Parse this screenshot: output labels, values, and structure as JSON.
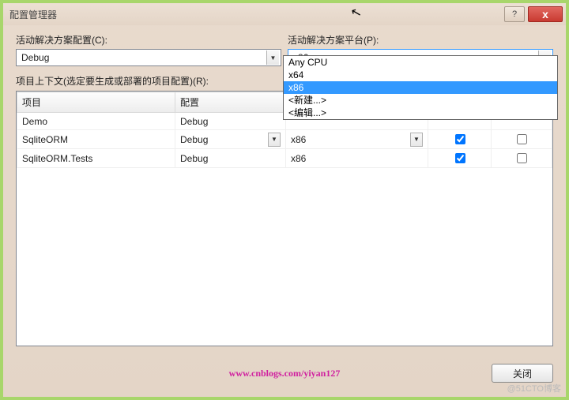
{
  "title": "配置管理器",
  "help_glyph": "?",
  "close_glyph": "x",
  "labels": {
    "solution_config": "活动解决方案配置(C):",
    "solution_platform": "活动解决方案平台(P):",
    "context": "项目上下文(选定要生成或部署的项目配置)(R):"
  },
  "solution_config_value": "Debug",
  "solution_platform_value": "x86",
  "platform_options": [
    {
      "label": "Any CPU",
      "selected": false
    },
    {
      "label": "x64",
      "selected": false
    },
    {
      "label": "x86",
      "selected": true
    },
    {
      "label": "<新建...>",
      "selected": false
    },
    {
      "label": "<编辑...>",
      "selected": false
    }
  ],
  "columns": {
    "project": "项目",
    "config": "配置",
    "platform": "",
    "build": "",
    "deploy": ""
  },
  "rows": [
    {
      "project": "Demo",
      "config": "Debug",
      "config_dd": false,
      "platform": "",
      "platform_dd": false,
      "build": null,
      "deploy": null
    },
    {
      "project": "SqliteORM",
      "config": "Debug",
      "config_dd": true,
      "platform": "x86",
      "platform_dd": true,
      "build": true,
      "deploy": false
    },
    {
      "project": "SqliteORM.Tests",
      "config": "Debug",
      "config_dd": false,
      "platform": "x86",
      "platform_dd": false,
      "build": true,
      "deploy": false
    }
  ],
  "footer": {
    "watermark": "www.cnblogs.com/yiyan127",
    "close_btn": "关闭"
  },
  "corner": "@51CTO博客"
}
